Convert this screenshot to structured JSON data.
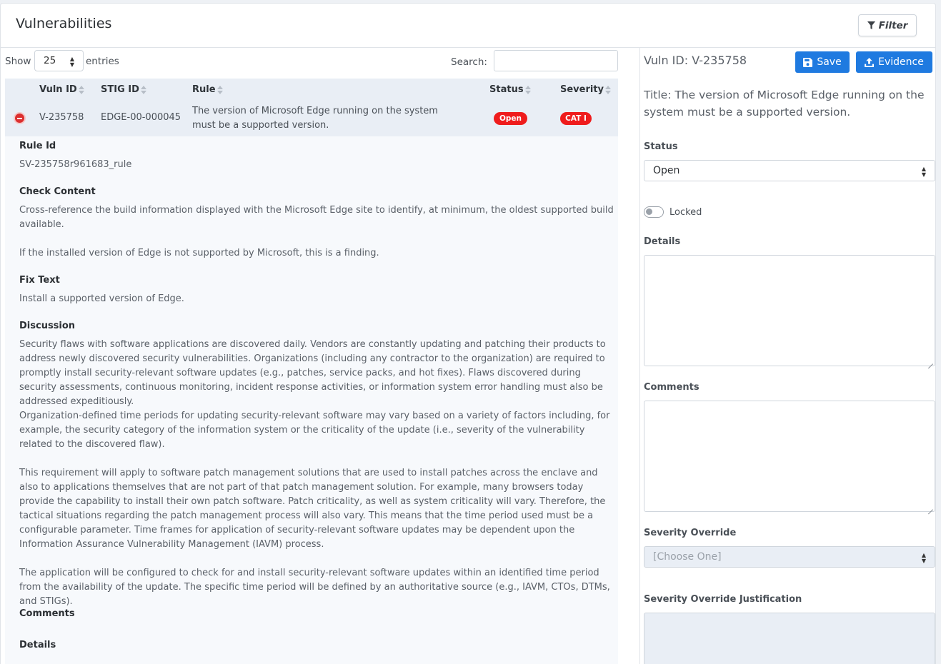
{
  "header": {
    "title": "Vulnerabilities",
    "filter_label": "Filter"
  },
  "table_controls": {
    "show_label": "Show",
    "entries_value": "25",
    "entries_label": "entries",
    "search_label": "Search:",
    "search_value": ""
  },
  "table": {
    "columns": [
      "Vuln ID",
      "STIG ID",
      "Rule",
      "Status",
      "Severity"
    ],
    "rows": [
      {
        "vuln_id": "V-235758",
        "stig_id": "EDGE-00-000045",
        "rule": "The version of Microsoft Edge running on the system must be a supported version.",
        "status": "Open",
        "severity": "CAT I"
      }
    ]
  },
  "details": {
    "rule_id_heading": "Rule Id",
    "rule_id": "SV-235758r961683_rule",
    "check_heading": "Check Content",
    "check_p1": "Cross-reference the build information displayed with the Microsoft Edge site to identify, at minimum, the oldest supported build available.",
    "check_p2": "If the installed version of Edge is not supported by Microsoft, this is a finding.",
    "fix_heading": "Fix Text",
    "fix_text": "Install a supported version of Edge.",
    "discussion_heading": "Discussion",
    "discussion_p1": "Security flaws with software applications are discovered daily. Vendors are constantly updating and patching their products to address newly discovered security vulnerabilities. Organizations (including any contractor to the organization) are required to promptly install security-relevant software updates (e.g., patches, service packs, and hot fixes). Flaws discovered during security assessments, continuous monitoring, incident response activities, or information system error handling must also be addressed expeditiously.",
    "discussion_p2": "Organization-defined time periods for updating security-relevant software may vary based on a variety of factors including, for example, the security category of the information system or the criticality of the update (i.e., severity of the vulnerability related to the discovered flaw).",
    "discussion_p3": "This requirement will apply to software patch management solutions that are used to install patches across the enclave and also to applications themselves that are not part of that patch management solution. For example, many browsers today provide the capability to install their own patch software. Patch criticality, as well as system criticality will vary. Therefore, the tactical situations regarding the patch management process will also vary. This means that the time period used must be a configurable parameter. Time frames for application of security-relevant software updates may be dependent upon the Information Assurance Vulnerability Management (IAVM) process.",
    "discussion_p4": "The application will be configured to check for and install security-relevant software updates within an identified time period from the availability of the update. The specific time period will be defined by an authoritative source (e.g., IAVM, CTOs, DTMs, and STIGs).",
    "comments_heading": "Comments",
    "details_heading": "Details"
  },
  "sidepanel": {
    "vuln_id": "Vuln ID: V-235758",
    "save_label": "Save",
    "evidence_label": "Evidence",
    "title": "Title: The version of Microsoft Edge running on the system must be a supported version.",
    "status_label": "Status",
    "status_value": "Open",
    "locked_label": "Locked",
    "details_label": "Details",
    "comments_label": "Comments",
    "severity_override_label": "Severity Override",
    "severity_override_placeholder": "[Choose One]",
    "justification_label": "Severity Override Justification"
  },
  "colors": {
    "accent": "#1f7ae0",
    "danger": "#ef1c1c",
    "header_bg": "#e9eef5"
  }
}
